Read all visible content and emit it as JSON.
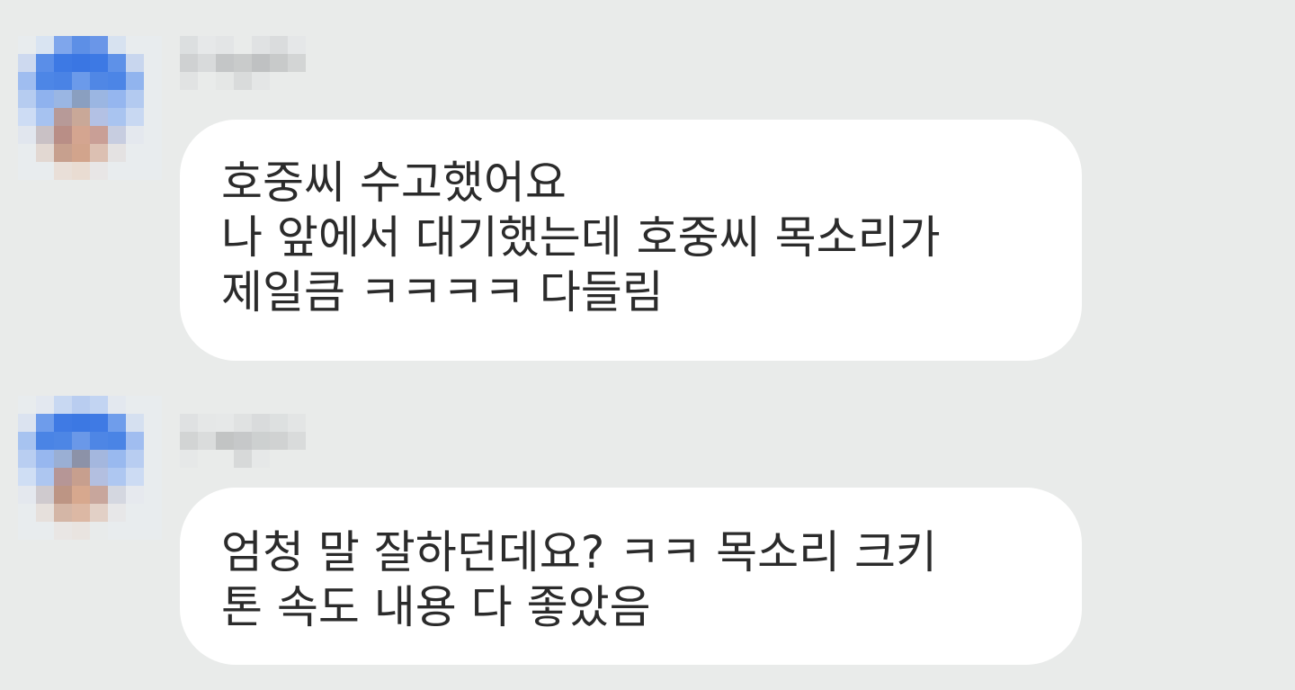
{
  "colors": {
    "background": "#e9ebea",
    "bubble": "#ffffff",
    "text": "#2b2b2b"
  },
  "messages": [
    {
      "avatar_icon": "pixelated-avatar-icon",
      "sender_name_blurred": true,
      "text": "호중씨 수고했어요\n나 앞에서 대기했는데 호중씨 목소리가\n제일큼 ㅋㅋㅋㅋ 다들림"
    },
    {
      "avatar_icon": "pixelated-avatar-icon",
      "sender_name_blurred": true,
      "text": "엄청 말 잘하던데요? ㅋㅋ 목소리 크키\n톤 속도 내용 다 좋았음"
    }
  ]
}
